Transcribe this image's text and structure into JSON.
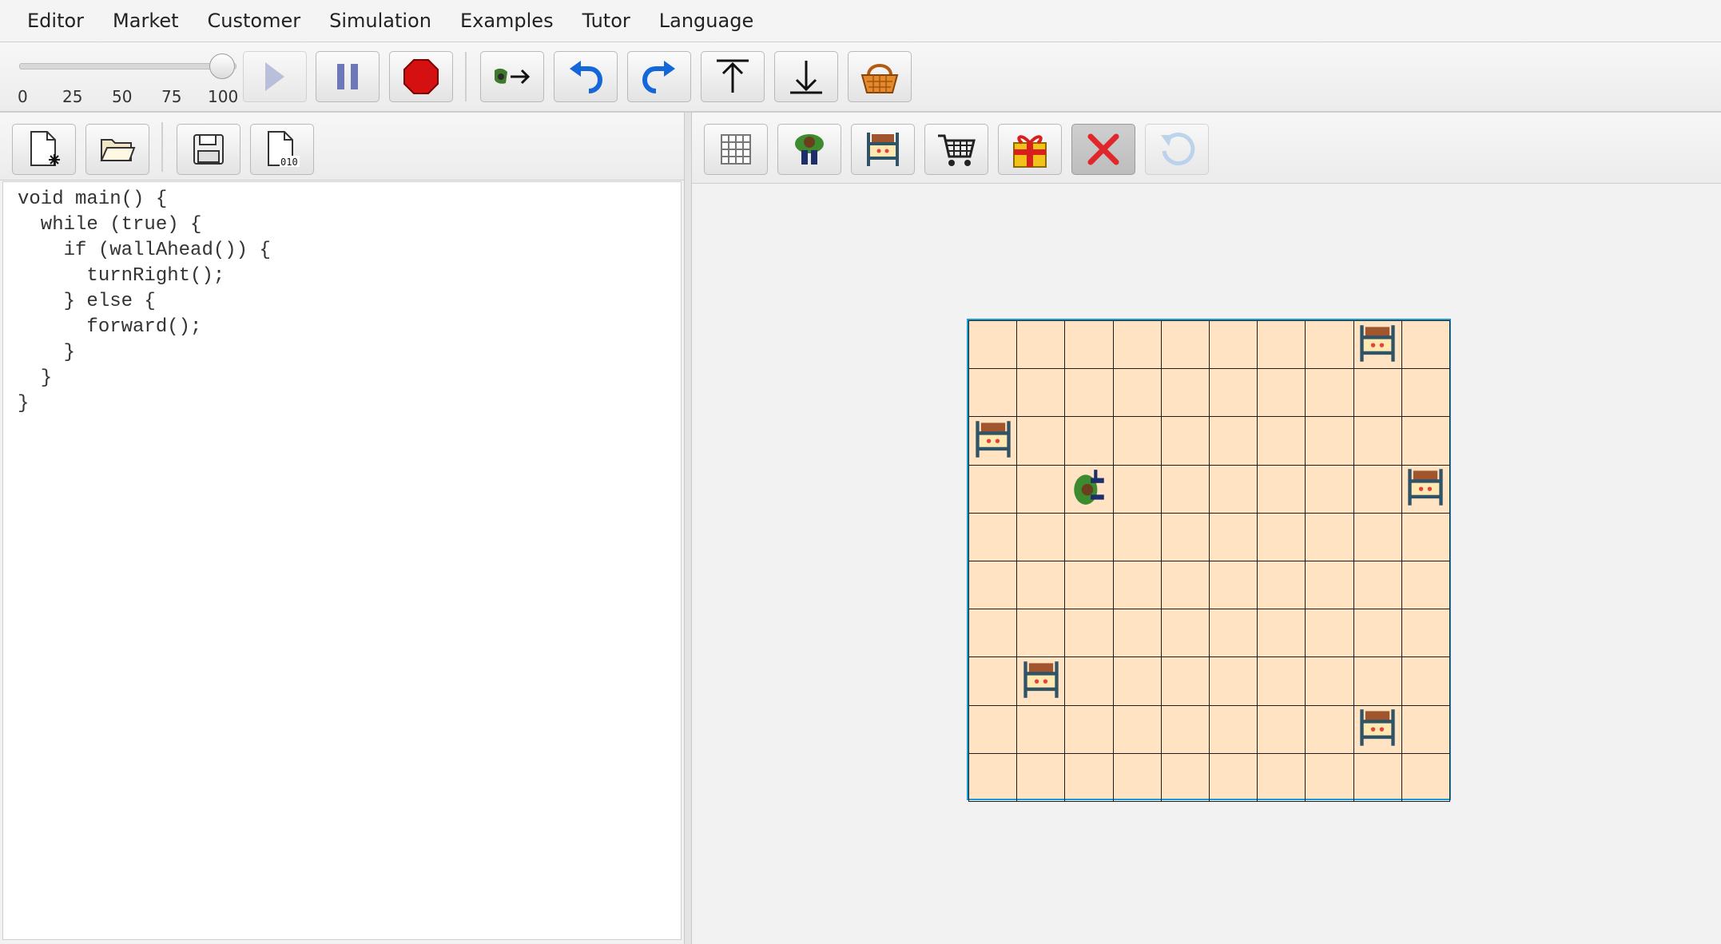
{
  "menu": [
    "Editor",
    "Market",
    "Customer",
    "Simulation",
    "Examples",
    "Tutor",
    "Language"
  ],
  "speed_slider": {
    "value": 100,
    "ticks": [
      "0",
      "25",
      "50",
      "75",
      "100"
    ]
  },
  "toolbar": {
    "buttons": [
      {
        "name": "play-button",
        "icon": "play-icon",
        "enabled": false
      },
      {
        "name": "pause-button",
        "icon": "pause-icon",
        "enabled": true
      },
      {
        "name": "stop-button",
        "icon": "stop-icon",
        "enabled": true
      },
      {
        "name": "step-into-button",
        "icon": "step-icon",
        "enabled": true
      },
      {
        "name": "undo-button",
        "icon": "undo-icon",
        "enabled": true
      },
      {
        "name": "redo-button",
        "icon": "redo-icon",
        "enabled": true
      },
      {
        "name": "upload-button",
        "icon": "upload-icon",
        "enabled": true
      },
      {
        "name": "download-button",
        "icon": "download-icon",
        "enabled": true
      },
      {
        "name": "basket-button",
        "icon": "basket-icon",
        "enabled": true
      }
    ]
  },
  "editor_toolbar": [
    "new-file-icon",
    "open-folder-icon",
    "save-icon",
    "bytecode-icon"
  ],
  "editor": {
    "code_lines": [
      "void main() {",
      "  while (true) {",
      "    if (wallAhead()) {",
      "      turnRight();",
      "    } else {",
      "      forward();",
      "    }",
      "  }",
      "}"
    ]
  },
  "world_toolbar": {
    "tools": [
      {
        "name": "grid-tool",
        "icon": "grid-icon",
        "selected": false,
        "enabled": true
      },
      {
        "name": "customer-tool",
        "icon": "customer-icon",
        "selected": false,
        "enabled": true
      },
      {
        "name": "shelf-tool",
        "icon": "shelf-icon",
        "selected": false,
        "enabled": true
      },
      {
        "name": "cart-tool",
        "icon": "cart-icon",
        "selected": false,
        "enabled": true
      },
      {
        "name": "gift-tool",
        "icon": "gift-icon",
        "selected": false,
        "enabled": true
      },
      {
        "name": "delete-tool",
        "icon": "delete-icon",
        "selected": true,
        "enabled": true
      },
      {
        "name": "reset-tool",
        "icon": "reset-icon",
        "selected": false,
        "enabled": false
      }
    ]
  },
  "world": {
    "rows": 10,
    "cols": 10,
    "colors": {
      "floor": "#ffe3c2",
      "grid": "#1e1e1e",
      "border": "#1a9ad6"
    },
    "shelves": [
      [
        0,
        8
      ],
      [
        2,
        0
      ],
      [
        3,
        9
      ],
      [
        7,
        1
      ],
      [
        8,
        8
      ]
    ],
    "customer": {
      "row": 3,
      "col": 2,
      "facing": "east"
    }
  }
}
